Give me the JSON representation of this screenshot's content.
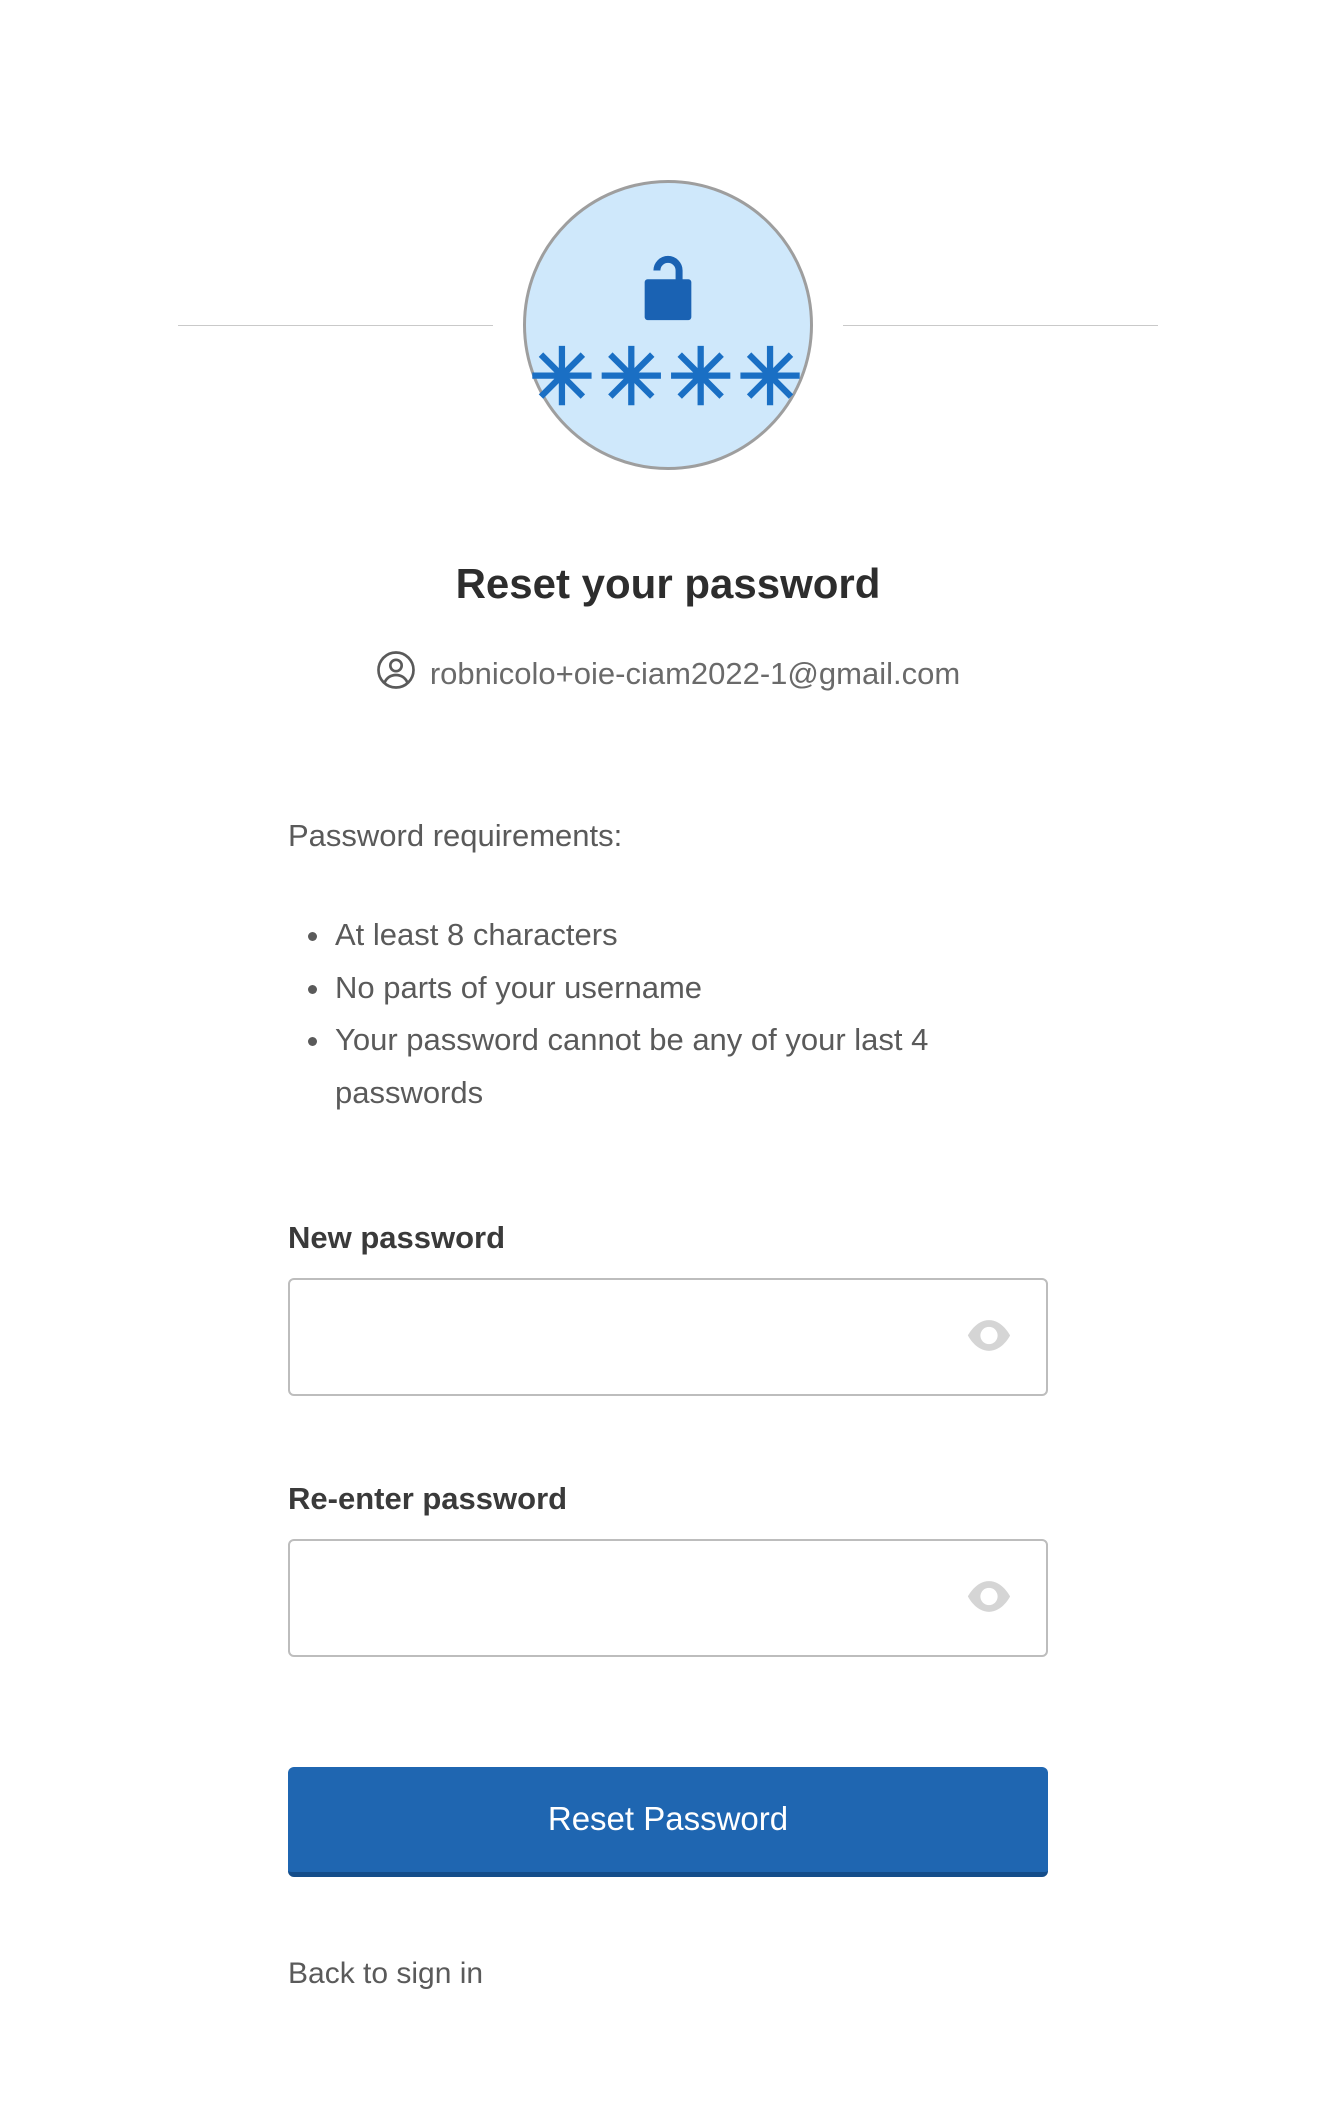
{
  "header": {
    "title": "Reset your password",
    "email": "robnicolo+oie-ciam2022-1@gmail.com",
    "asterisk_glyphs": "✳✳✳✳"
  },
  "requirements": {
    "label": "Password requirements:",
    "items": [
      "At least 8 characters",
      "No parts of your username",
      "Your password cannot be any of your last 4 passwords"
    ]
  },
  "fields": {
    "new_password": {
      "label": "New password",
      "value": ""
    },
    "confirm_password": {
      "label": "Re-enter password",
      "value": ""
    }
  },
  "actions": {
    "submit_label": "Reset Password",
    "back_label": "Back to sign in"
  }
}
